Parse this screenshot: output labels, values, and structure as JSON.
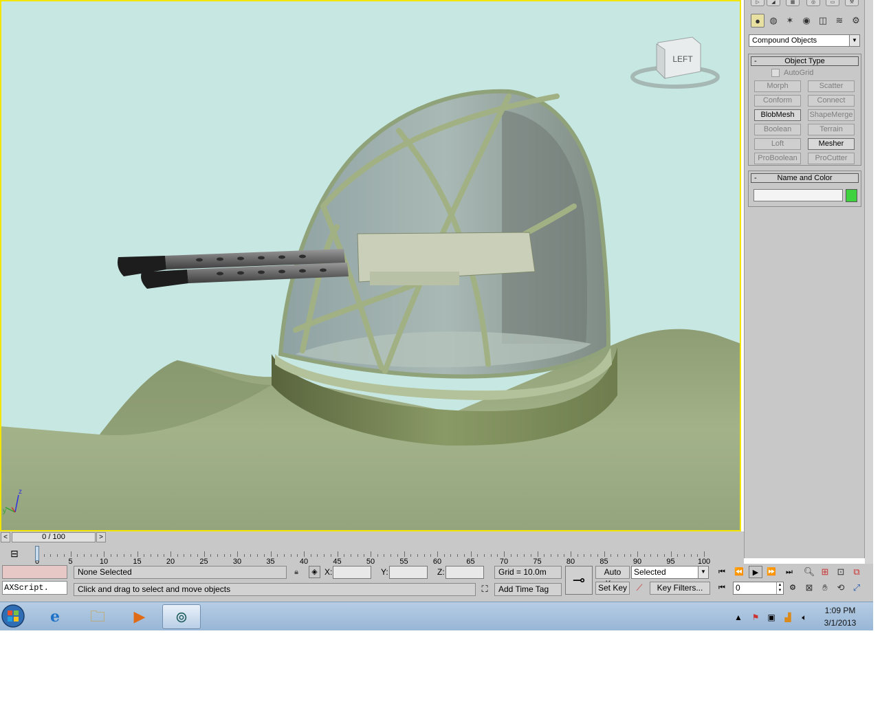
{
  "viewport": {
    "viewcube_label": "LEFT",
    "axis_z": "z",
    "axis_y": "y"
  },
  "command_panel": {
    "tabs": [
      "create-icon",
      "modify-icon",
      "hierarchy-icon",
      "motion-icon",
      "display-icon",
      "utilities-icon"
    ],
    "subcategories": [
      "geometry-icon",
      "shapes-icon",
      "lights-icon",
      "cameras-icon",
      "helpers-icon",
      "spacewarps-icon",
      "systems-icon"
    ],
    "category": "Compound Objects",
    "object_type": {
      "title": "Object Type",
      "collapse": "-",
      "autogrid": "AutoGrid",
      "buttons": [
        {
          "label": "Morph",
          "enabled": false
        },
        {
          "label": "Scatter",
          "enabled": false
        },
        {
          "label": "Conform",
          "enabled": false
        },
        {
          "label": "Connect",
          "enabled": false
        },
        {
          "label": "BlobMesh",
          "enabled": true
        },
        {
          "label": "ShapeMerge",
          "enabled": false
        },
        {
          "label": "Boolean",
          "enabled": false
        },
        {
          "label": "Terrain",
          "enabled": false
        },
        {
          "label": "Loft",
          "enabled": false
        },
        {
          "label": "Mesher",
          "enabled": true
        },
        {
          "label": "ProBoolean",
          "enabled": false
        },
        {
          "label": "ProCutter",
          "enabled": false
        }
      ]
    },
    "name_and_color": {
      "title": "Name and Color",
      "collapse": "-",
      "name_value": "",
      "color": "#3ed23e"
    }
  },
  "time_slider": {
    "label": "0 / 100",
    "left": "<",
    "right": ">"
  },
  "trackbar": {
    "labels": [
      "0",
      "5",
      "10",
      "15",
      "20",
      "25",
      "30",
      "35",
      "40",
      "45",
      "50",
      "55",
      "60",
      "65",
      "70",
      "75",
      "80",
      "85",
      "90",
      "95",
      "100"
    ]
  },
  "status": {
    "maxscript": "AXScript.",
    "selection": "None Selected",
    "prompt": "Click and drag to select and move objects",
    "x_label": "X:",
    "y_label": "Y:",
    "z_label": "Z:",
    "grid": "Grid = 10.0m",
    "add_time_tag": "Add Time Tag",
    "auto_key": "Auto Key",
    "set_key": "Set Key",
    "selection_set": "Selected",
    "key_filters": "Key Filters...",
    "current_frame": "0"
  },
  "taskbar": {
    "time": "1:09 PM",
    "date": "3/1/2013"
  }
}
